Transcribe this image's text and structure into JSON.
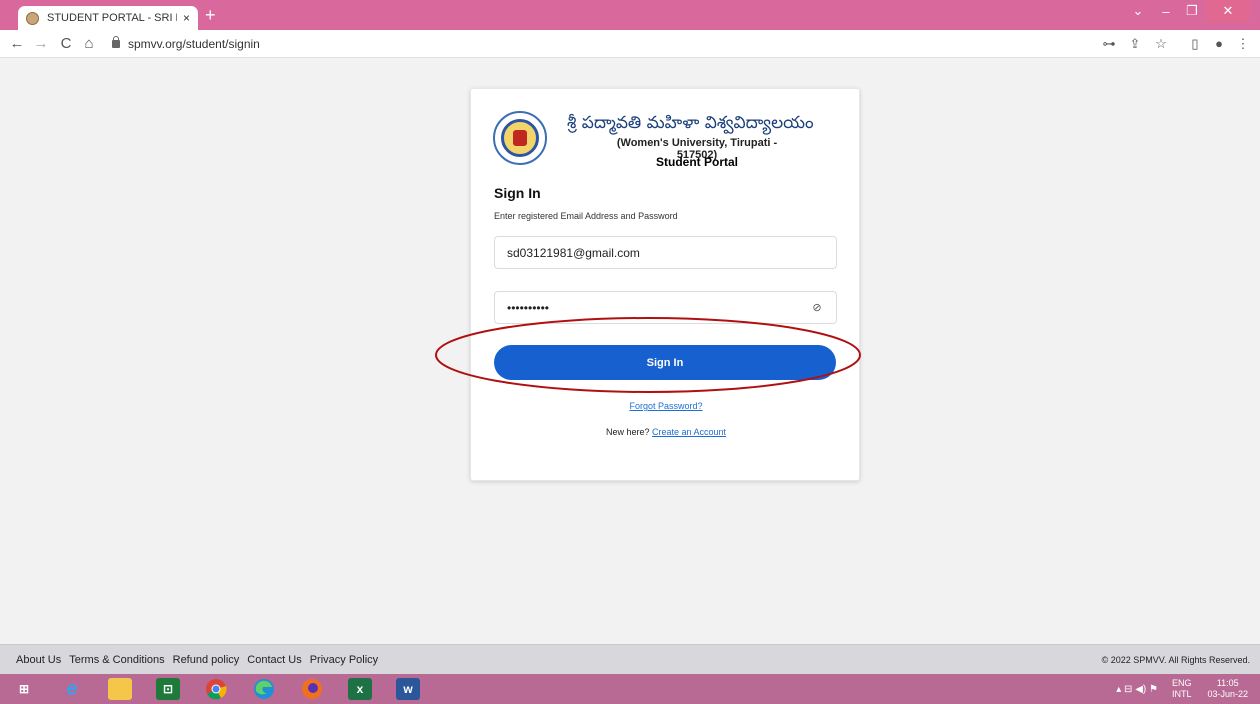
{
  "browser": {
    "tab_title": "STUDENT PORTAL - SRI PADMAV",
    "tab_close": "×",
    "new_tab": "+",
    "url": "spmvv.org/student/signin",
    "window_controls": {
      "dropdown": "⌄",
      "minimize": "–",
      "maximize": "❐",
      "close": "✕"
    },
    "nav_icons": {
      "back": "←",
      "forward": "→",
      "reload": "C",
      "home": "⌂"
    },
    "toolbar_icons": {
      "key": "⊶",
      "share": "⇪",
      "star": "☆",
      "sidepanel": "▯",
      "profile": "●",
      "menu": "⋮"
    }
  },
  "login": {
    "university_name_telugu": "శ్రీ పద్మావతి మహిళా విశ్వవిద్యాలయం",
    "university_subtitle": "(Women's University, Tirupati - 517502)",
    "portal_title": "Student Portal",
    "heading": "Sign In",
    "instruction": "Enter registered Email Address and Password",
    "email_value": "sd03121981@gmail.com",
    "password_masked": "••••••••••",
    "eye_glyph": "⊘",
    "signin_button": "Sign In",
    "forgot_password": "Forgot Password?",
    "new_here": "New here? ",
    "create_account": "Create an Account",
    "highlight_color": "#b01010",
    "button_color": "#1760d0"
  },
  "footer": {
    "links": [
      "About Us",
      "Terms & Conditions",
      "Refund policy",
      "Contact Us",
      "Privacy Policy"
    ],
    "copyright": "© 2022 SPMVV. All Rights Reserved."
  },
  "taskbar": {
    "start": "⊞",
    "ie": "e",
    "store": "⊡",
    "excel": "x",
    "word": "w",
    "tray_icons": "▴  ⊟  ◀)  ⚑",
    "lang_top": "ENG",
    "lang_bottom": "INTL",
    "time": "11:05",
    "date": "03-Jun-22"
  }
}
